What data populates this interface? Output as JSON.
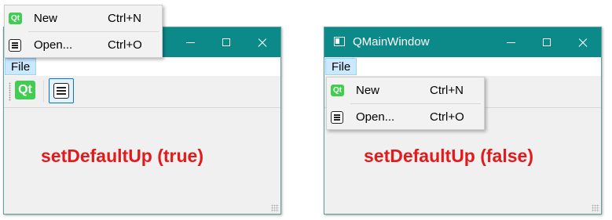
{
  "left": {
    "menu": "File",
    "caption": "setDefaultUp (true)",
    "popup_items": [
      {
        "label": "New",
        "shortcut": "Ctrl+N",
        "icon": "qt-icon"
      },
      {
        "label": "Open...",
        "shortcut": "Ctrl+O",
        "icon": "document-icon"
      }
    ],
    "toolbar_icons": [
      "qt-icon",
      "document-icon"
    ]
  },
  "right": {
    "title": "QMainWindow",
    "menu": "File",
    "caption": "setDefaultUp (false)",
    "popup_items": [
      {
        "label": "New",
        "shortcut": "Ctrl+N",
        "icon": "qt-icon"
      },
      {
        "label": "Open...",
        "shortcut": "Ctrl+O",
        "icon": "document-icon"
      }
    ]
  },
  "icon_text": "Qt",
  "colors": {
    "titlebar": "#0c8a8a",
    "caption": "#e31a1c",
    "qt_green": "#41cd52"
  }
}
